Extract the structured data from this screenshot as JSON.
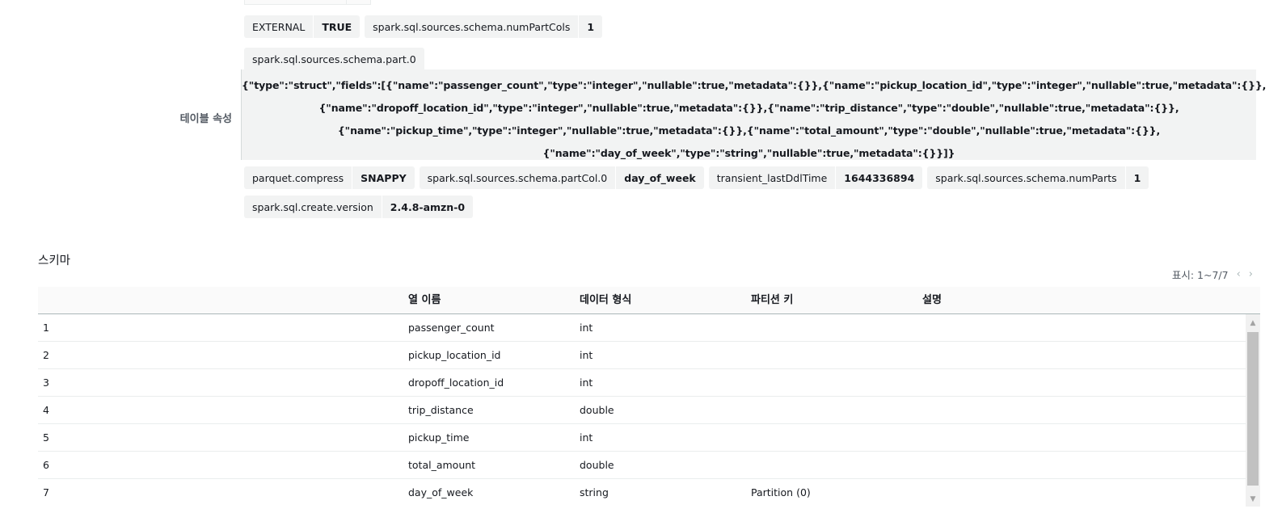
{
  "properties": {
    "label": "테이블 속성",
    "row1": [
      {
        "key": "EXTERNAL",
        "value": "TRUE"
      },
      {
        "key": "spark.sql.sources.schema.numPartCols",
        "value": "1"
      }
    ],
    "schema_part": {
      "key": "spark.sql.sources.schema.part.0",
      "lines": [
        "{\"type\":\"struct\",\"fields\":[{\"name\":\"passenger_count\",\"type\":\"integer\",\"nullable\":true,\"metadata\":{}},{\"name\":\"pickup_location_id\",\"type\":\"integer\",\"nullable\":true,\"metadata\":{}},",
        "{\"name\":\"dropoff_location_id\",\"type\":\"integer\",\"nullable\":true,\"metadata\":{}},{\"name\":\"trip_distance\",\"type\":\"double\",\"nullable\":true,\"metadata\":{}},",
        "{\"name\":\"pickup_time\",\"type\":\"integer\",\"nullable\":true,\"metadata\":{}},{\"name\":\"total_amount\",\"type\":\"double\",\"nullable\":true,\"metadata\":{}},",
        "{\"name\":\"day_of_week\",\"type\":\"string\",\"nullable\":true,\"metadata\":{}}]}"
      ]
    },
    "row2": [
      {
        "key": "parquet.compress",
        "value": "SNAPPY"
      },
      {
        "key": "spark.sql.sources.schema.partCol.0",
        "value": "day_of_week"
      },
      {
        "key": "transient_lastDdlTime",
        "value": "1644336894"
      },
      {
        "key": "spark.sql.sources.schema.numParts",
        "value": "1"
      }
    ],
    "row3": [
      {
        "key": "spark.sql.create.version",
        "value": "2.4.8-amzn-0"
      }
    ]
  },
  "schema": {
    "title": "스키마",
    "pagination": {
      "label": "표시: 1~7/7",
      "prev_icon": "chevron-left-icon",
      "next_icon": "chevron-right-icon"
    },
    "columns": [
      "",
      "열 이름",
      "데이터 형식",
      "파티션 키",
      "설명"
    ],
    "rows": [
      [
        "1",
        "passenger_count",
        "int",
        "",
        ""
      ],
      [
        "2",
        "pickup_location_id",
        "int",
        "",
        ""
      ],
      [
        "3",
        "dropoff_location_id",
        "int",
        "",
        ""
      ],
      [
        "4",
        "trip_distance",
        "double",
        "",
        ""
      ],
      [
        "5",
        "pickup_time",
        "int",
        "",
        ""
      ],
      [
        "6",
        "total_amount",
        "double",
        "",
        ""
      ],
      [
        "7",
        "day_of_week",
        "string",
        "Partition (0)",
        ""
      ]
    ]
  }
}
